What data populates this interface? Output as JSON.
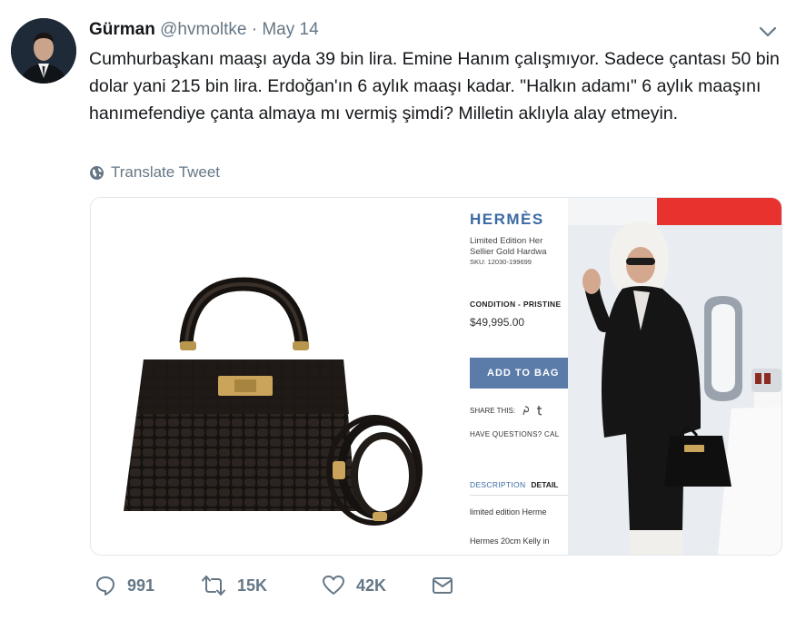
{
  "tweet": {
    "name": "Gürman",
    "handle": "@hvmoltke",
    "separator": "·",
    "date": "May 14",
    "text": "Cumhurbaşkanı maaşı ayda 39 bin lira. Emine Hanım çalışmıyor. Sadece çantası 50 bin dolar yani 215 bin lira. Erdoğan'ın 6 aylık maaşı kadar. \"Halkın adamı\" 6 aylık maaşını hanımefendiye çanta almaya mı vermiş şimdi? Milletin aklıyla alay etmeyin.",
    "translate_label": "Translate Tweet"
  },
  "media": {
    "brand": "HERMÈS",
    "product_line1": "Limited Edition Her",
    "product_line2": "Sellier Gold Hardwa",
    "sku": "SKU: 12030-199699",
    "condition": "CONDITION - PRISTINE",
    "price": "$49,995.00",
    "add_to_bag": "ADD TO BAG",
    "share_label": "SHARE THIS:",
    "have_questions": "HAVE QUESTIONS? CAL",
    "tab_description": "DESCRIPTION",
    "tab_details": "DETAIL",
    "desc_line1": "limited edition Herme",
    "desc_line2": "Hermes 20cm Kelly in"
  },
  "actions": {
    "replies": "991",
    "retweets": "15K",
    "likes": "42K"
  },
  "icons": {
    "more": "chevron-down-icon",
    "translate": "globe-icon",
    "reply": "reply-icon",
    "retweet": "retweet-icon",
    "like": "heart-icon",
    "dm": "envelope-icon"
  }
}
